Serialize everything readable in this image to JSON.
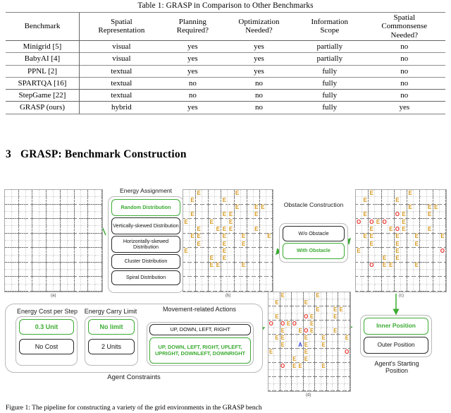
{
  "table": {
    "caption": "Table 1: GRASP in Comparison to Other Benchmarks",
    "headers": [
      "Benchmark",
      "Spatial Representation",
      "Planning Required?",
      "Optimization Needed?",
      "Information Scope",
      "Spatial Commonsense Needed?"
    ],
    "headers_lines": [
      [
        "Benchmark"
      ],
      [
        "Spatial",
        "Representation"
      ],
      [
        "Planning",
        "Required?"
      ],
      [
        "Optimization",
        "Needed?"
      ],
      [
        "Information",
        "Scope"
      ],
      [
        "Spatial",
        "Commonsense",
        "Needed?"
      ]
    ],
    "rows": [
      {
        "bold": false,
        "cells": [
          "Minigrid [5]",
          "visual",
          "yes",
          "yes",
          "partially",
          "no"
        ]
      },
      {
        "bold": false,
        "cells": [
          "BabyAI [4]",
          "visual",
          "yes",
          "yes",
          "partially",
          "no"
        ]
      },
      {
        "bold": false,
        "cells": [
          "PPNL [2]",
          "textual",
          "yes",
          "yes",
          "fully",
          "no"
        ]
      },
      {
        "bold": false,
        "cells": [
          "SPARTQA [16]",
          "textual",
          "no",
          "no",
          "fully",
          "no"
        ]
      },
      {
        "bold": false,
        "cells": [
          "StepGame [22]",
          "textual",
          "no",
          "no",
          "fully",
          "no"
        ]
      },
      {
        "bold": true,
        "cells": [
          "GRASP (ours)",
          "hybrid",
          "yes",
          "no",
          "fully",
          "yes"
        ]
      }
    ]
  },
  "section": {
    "number": "3",
    "title": "GRASP: Benchmark Construction"
  },
  "figure": {
    "caption": "Figure 1: The pipeline for constructing a variety of the grid environments in the GRASP bench",
    "panel_labels": {
      "a": "(a)",
      "b": "(b)",
      "c": "(c)",
      "d": "(d)"
    },
    "energy_assignment": {
      "title": "Energy Assignment",
      "options": [
        {
          "label": "Random Distribution",
          "selected": true
        },
        {
          "label": "Vertically-skewed Distribution",
          "selected": false
        },
        {
          "label": "Horizontally-skewed Distribution",
          "selected": false
        },
        {
          "label": "Cluster Distribution",
          "selected": false
        },
        {
          "label": "Spiral Distribution",
          "selected": false
        }
      ]
    },
    "obstacle_construction": {
      "title": "Obstacle Construction",
      "options": [
        {
          "label": "W/o Obstacle",
          "selected": false
        },
        {
          "label": "With Obstacle",
          "selected": true
        }
      ]
    },
    "agent_constraints": {
      "title": "Agent Constraints",
      "groups": [
        {
          "title": "Energy Cost per Step",
          "options": [
            {
              "label": "0.3 Unit",
              "selected": true
            },
            {
              "label": "No Cost",
              "selected": false
            }
          ]
        },
        {
          "title": "Energy Carry Limit",
          "options": [
            {
              "label": "No limit",
              "selected": true
            },
            {
              "label": "2 Units",
              "selected": false
            }
          ]
        },
        {
          "title": "Movement-related Actions",
          "options": [
            {
              "label": "UP, DOWN, LEFT, RIGHT",
              "selected": false
            },
            {
              "label": "UP, DOWN, LEFT, RIGHT, UPLEFT, UPRIGHT, DOWNLEFT, DOWNRIGHT",
              "selected": true
            }
          ]
        }
      ]
    },
    "starting_position": {
      "title": "Agent's Starting Position",
      "options": [
        {
          "label": "Inner Position",
          "selected": true
        },
        {
          "label": "Outer Position",
          "selected": false
        }
      ]
    },
    "markers": {
      "energy": "E",
      "obstacle": "O",
      "agent": "A"
    },
    "colors": {
      "energy": "#d79a22",
      "obstacle": "#e8302a",
      "agent": "#2d3fd4",
      "selected": "#3cab33",
      "grid_line": "#cfcfcf",
      "block_line": "#7a7a7a"
    },
    "grids": {
      "a": {
        "cols": 14,
        "rows": 14,
        "block": 2,
        "cells": []
      },
      "b": {
        "cols": 14,
        "rows": 14,
        "block": 2,
        "cells": [
          {
            "c": 2,
            "r": 0,
            "m": "E"
          },
          {
            "c": 8,
            "r": 0,
            "m": "E"
          },
          {
            "c": 1,
            "r": 1,
            "m": "E"
          },
          {
            "c": 6,
            "r": 1,
            "m": "E"
          },
          {
            "c": 8,
            "r": 2,
            "m": "E"
          },
          {
            "c": 11,
            "r": 2,
            "m": "E"
          },
          {
            "c": 12,
            "r": 2,
            "m": "E"
          },
          {
            "c": 1,
            "r": 3,
            "m": "E"
          },
          {
            "c": 6,
            "r": 3,
            "m": "E"
          },
          {
            "c": 7,
            "r": 3,
            "m": "E"
          },
          {
            "c": 11,
            "r": 3,
            "m": "E"
          },
          {
            "c": 0,
            "r": 4,
            "m": "E"
          },
          {
            "c": 4,
            "r": 4,
            "m": "E"
          },
          {
            "c": 7,
            "r": 4,
            "m": "E"
          },
          {
            "c": 2,
            "r": 5,
            "m": "E"
          },
          {
            "c": 5,
            "r": 5,
            "m": "E"
          },
          {
            "c": 6,
            "r": 5,
            "m": "E"
          },
          {
            "c": 7,
            "r": 5,
            "m": "E"
          },
          {
            "c": 11,
            "r": 5,
            "m": "E"
          },
          {
            "c": 1,
            "r": 6,
            "m": "E"
          },
          {
            "c": 2,
            "r": 6,
            "m": "E"
          },
          {
            "c": 6,
            "r": 6,
            "m": "E"
          },
          {
            "c": 9,
            "r": 6,
            "m": "E"
          },
          {
            "c": 13,
            "r": 6,
            "m": "E"
          },
          {
            "c": 2,
            "r": 7,
            "m": "E"
          },
          {
            "c": 6,
            "r": 7,
            "m": "E"
          },
          {
            "c": 9,
            "r": 7,
            "m": "E"
          },
          {
            "c": 0,
            "r": 8,
            "m": "E"
          },
          {
            "c": 6,
            "r": 8,
            "m": "E"
          },
          {
            "c": 4,
            "r": 9,
            "m": "E"
          },
          {
            "c": 6,
            "r": 9,
            "m": "E"
          },
          {
            "c": 4,
            "r": 10,
            "m": "E"
          },
          {
            "c": 5,
            "r": 10,
            "m": "E"
          },
          {
            "c": 9,
            "r": 10,
            "m": "E"
          }
        ]
      },
      "c": {
        "cols": 14,
        "rows": 14,
        "block": 2,
        "cells": [
          {
            "c": 2,
            "r": 0,
            "m": "E"
          },
          {
            "c": 8,
            "r": 0,
            "m": "E"
          },
          {
            "c": 1,
            "r": 1,
            "m": "E"
          },
          {
            "c": 6,
            "r": 1,
            "m": "E"
          },
          {
            "c": 8,
            "r": 2,
            "m": "E"
          },
          {
            "c": 11,
            "r": 2,
            "m": "E"
          },
          {
            "c": 12,
            "r": 2,
            "m": "E"
          },
          {
            "c": 1,
            "r": 3,
            "m": "E"
          },
          {
            "c": 6,
            "r": 3,
            "m": "O"
          },
          {
            "c": 7,
            "r": 3,
            "m": "E"
          },
          {
            "c": 11,
            "r": 3,
            "m": "E"
          },
          {
            "c": 0,
            "r": 4,
            "m": "O"
          },
          {
            "c": 2,
            "r": 4,
            "m": "O"
          },
          {
            "c": 3,
            "r": 4,
            "m": "E"
          },
          {
            "c": 4,
            "r": 4,
            "m": "O"
          },
          {
            "c": 7,
            "r": 4,
            "m": "E"
          },
          {
            "c": 2,
            "r": 5,
            "m": "E"
          },
          {
            "c": 5,
            "r": 5,
            "m": "E"
          },
          {
            "c": 6,
            "r": 5,
            "m": "O"
          },
          {
            "c": 7,
            "r": 5,
            "m": "E"
          },
          {
            "c": 11,
            "r": 5,
            "m": "E"
          },
          {
            "c": 1,
            "r": 6,
            "m": "E"
          },
          {
            "c": 2,
            "r": 6,
            "m": "E"
          },
          {
            "c": 6,
            "r": 6,
            "m": "E"
          },
          {
            "c": 9,
            "r": 6,
            "m": "E"
          },
          {
            "c": 13,
            "r": 6,
            "m": "E"
          },
          {
            "c": 2,
            "r": 7,
            "m": "E"
          },
          {
            "c": 6,
            "r": 7,
            "m": "E"
          },
          {
            "c": 9,
            "r": 7,
            "m": "E"
          },
          {
            "c": 0,
            "r": 8,
            "m": "E"
          },
          {
            "c": 6,
            "r": 8,
            "m": "E"
          },
          {
            "c": 13,
            "r": 8,
            "m": "O"
          },
          {
            "c": 4,
            "r": 9,
            "m": "E"
          },
          {
            "c": 6,
            "r": 9,
            "m": "E"
          },
          {
            "c": 2,
            "r": 10,
            "m": "O"
          },
          {
            "c": 4,
            "r": 10,
            "m": "E"
          },
          {
            "c": 5,
            "r": 10,
            "m": "E"
          },
          {
            "c": 9,
            "r": 10,
            "m": "E"
          }
        ]
      },
      "d": {
        "cols": 14,
        "rows": 14,
        "block": 2,
        "cells": [
          {
            "c": 2,
            "r": 0,
            "m": "E"
          },
          {
            "c": 8,
            "r": 0,
            "m": "E"
          },
          {
            "c": 1,
            "r": 1,
            "m": "E"
          },
          {
            "c": 6,
            "r": 1,
            "m": "E"
          },
          {
            "c": 8,
            "r": 2,
            "m": "E"
          },
          {
            "c": 11,
            "r": 2,
            "m": "E"
          },
          {
            "c": 12,
            "r": 2,
            "m": "E"
          },
          {
            "c": 1,
            "r": 3,
            "m": "E"
          },
          {
            "c": 6,
            "r": 3,
            "m": "O"
          },
          {
            "c": 7,
            "r": 3,
            "m": "E"
          },
          {
            "c": 11,
            "r": 3,
            "m": "E"
          },
          {
            "c": 0,
            "r": 4,
            "m": "O"
          },
          {
            "c": 2,
            "r": 4,
            "m": "O"
          },
          {
            "c": 3,
            "r": 4,
            "m": "E"
          },
          {
            "c": 4,
            "r": 4,
            "m": "O"
          },
          {
            "c": 7,
            "r": 4,
            "m": "E"
          },
          {
            "c": 2,
            "r": 5,
            "m": "E"
          },
          {
            "c": 5,
            "r": 5,
            "m": "E"
          },
          {
            "c": 6,
            "r": 5,
            "m": "O"
          },
          {
            "c": 7,
            "r": 5,
            "m": "E"
          },
          {
            "c": 11,
            "r": 5,
            "m": "E"
          },
          {
            "c": 1,
            "r": 6,
            "m": "E"
          },
          {
            "c": 2,
            "r": 6,
            "m": "E"
          },
          {
            "c": 6,
            "r": 6,
            "m": "E"
          },
          {
            "c": 9,
            "r": 6,
            "m": "E"
          },
          {
            "c": 13,
            "r": 6,
            "m": "E"
          },
          {
            "c": 2,
            "r": 7,
            "m": "E"
          },
          {
            "c": 5,
            "r": 7,
            "m": "A"
          },
          {
            "c": 6,
            "r": 7,
            "m": "E"
          },
          {
            "c": 9,
            "r": 7,
            "m": "E"
          },
          {
            "c": 0,
            "r": 8,
            "m": "E"
          },
          {
            "c": 6,
            "r": 8,
            "m": "E"
          },
          {
            "c": 13,
            "r": 8,
            "m": "O"
          },
          {
            "c": 4,
            "r": 9,
            "m": "E"
          },
          {
            "c": 6,
            "r": 9,
            "m": "E"
          },
          {
            "c": 2,
            "r": 10,
            "m": "O"
          },
          {
            "c": 4,
            "r": 10,
            "m": "E"
          },
          {
            "c": 5,
            "r": 10,
            "m": "E"
          },
          {
            "c": 9,
            "r": 10,
            "m": "E"
          }
        ]
      }
    }
  }
}
